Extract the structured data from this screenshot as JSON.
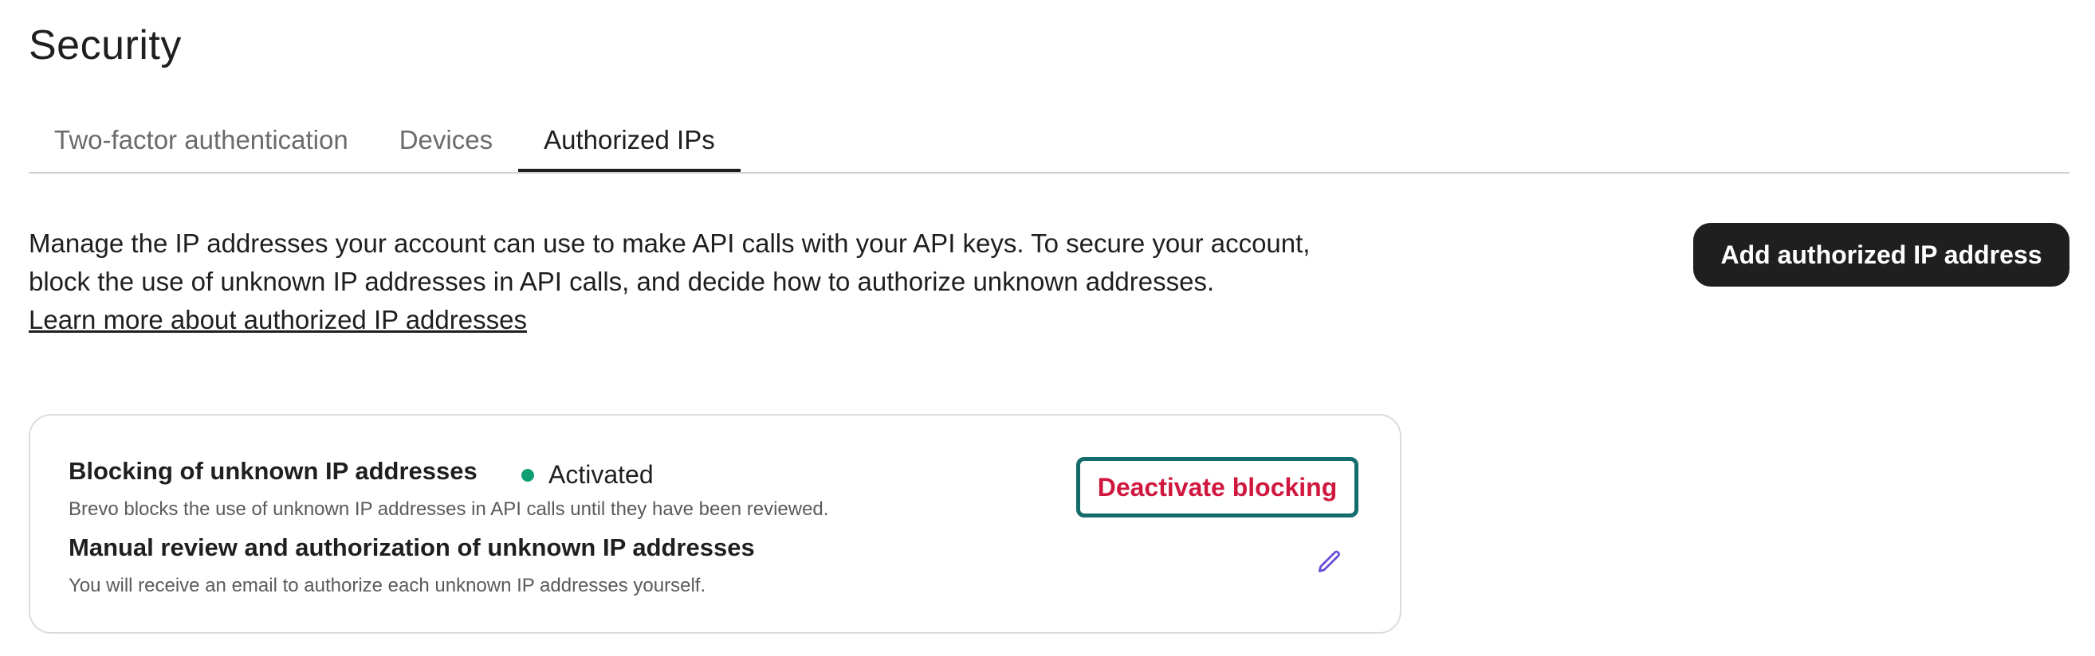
{
  "page": {
    "title": "Security"
  },
  "tabs": [
    {
      "label": "Two-factor authentication",
      "active": false
    },
    {
      "label": "Devices",
      "active": false
    },
    {
      "label": "Authorized IPs",
      "active": true
    }
  ],
  "intro": {
    "line1": "Manage the IP addresses your account can use to make API calls with your API keys. To secure your account,",
    "line2": "block the use of unknown IP addresses in API calls, and decide how to authorize unknown addresses.",
    "link": "Learn more about authorized IP addresses"
  },
  "actions": {
    "add_label": "Add authorized IP address"
  },
  "card": {
    "blocking": {
      "title": "Blocking of unknown IP addresses",
      "status": "Activated",
      "status_color": "#0f9d72",
      "description": "Brevo blocks the use of unknown IP addresses in API calls until they have been reviewed.",
      "button_label": "Deactivate blocking"
    },
    "review": {
      "title": "Manual review and authorization of unknown IP addresses",
      "description": "You will receive an email to authorize each unknown IP addresses yourself.",
      "edit_icon": "pencil-icon"
    }
  },
  "colors": {
    "accent_dark": "#1f1f1f",
    "danger": "#d0183f",
    "focus_ring": "#146b6b",
    "edit_icon": "#6a4fd6"
  }
}
